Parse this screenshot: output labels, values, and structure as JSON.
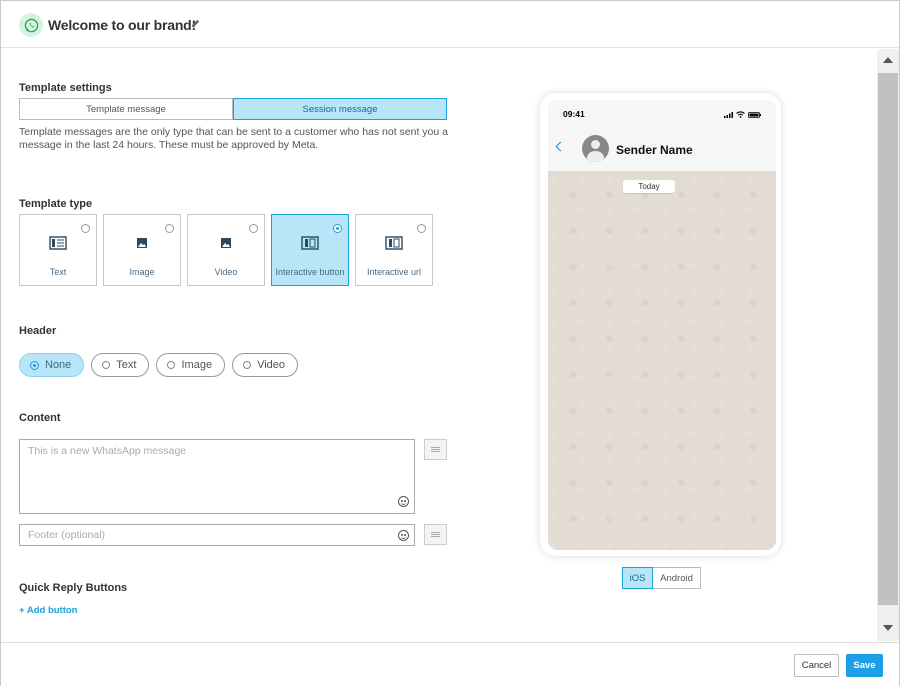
{
  "header": {
    "title": "Welcome to our brand!",
    "logo_icon": "whatsapp-icon",
    "edit_icon": "pencil-icon"
  },
  "template_settings": {
    "label": "Template settings",
    "options": [
      "Template message",
      "Session message"
    ],
    "selected": "Session message",
    "description": "Template messages are the only type that can be sent to a customer who has not sent you a message in the last 24 hours. These must be approved by Meta."
  },
  "template_type": {
    "label": "Template type",
    "cards": [
      {
        "label": "Text",
        "icon": "text-icon"
      },
      {
        "label": "Image",
        "icon": "image-icon"
      },
      {
        "label": "Video",
        "icon": "video-icon"
      },
      {
        "label": "Interactive button",
        "icon": "interactive-button-icon"
      },
      {
        "label": "Interactive url",
        "icon": "interactive-url-icon"
      }
    ],
    "selected": "Interactive button"
  },
  "header_section": {
    "label": "Header",
    "options": [
      "None",
      "Text",
      "Image",
      "Video"
    ],
    "selected": "None"
  },
  "content": {
    "label": "Content",
    "message_placeholder": "This is a new WhatsApp message",
    "footer_placeholder": "Footer (optional)"
  },
  "quick_reply": {
    "label": "Quick Reply Buttons",
    "add_button": "+ Add button"
  },
  "preview": {
    "time": "09:41",
    "sender_name": "Sender Name",
    "date_chip": "Today",
    "os_options": [
      "iOS",
      "Android"
    ],
    "selected_os": "iOS"
  },
  "footer": {
    "cancel": "Cancel",
    "save": "Save"
  },
  "colors": {
    "accent": "#1a9fd8",
    "selected_bg": "#b8e6f8",
    "save_button": "#1a9fe8",
    "whatsapp_green": "#25d366"
  }
}
